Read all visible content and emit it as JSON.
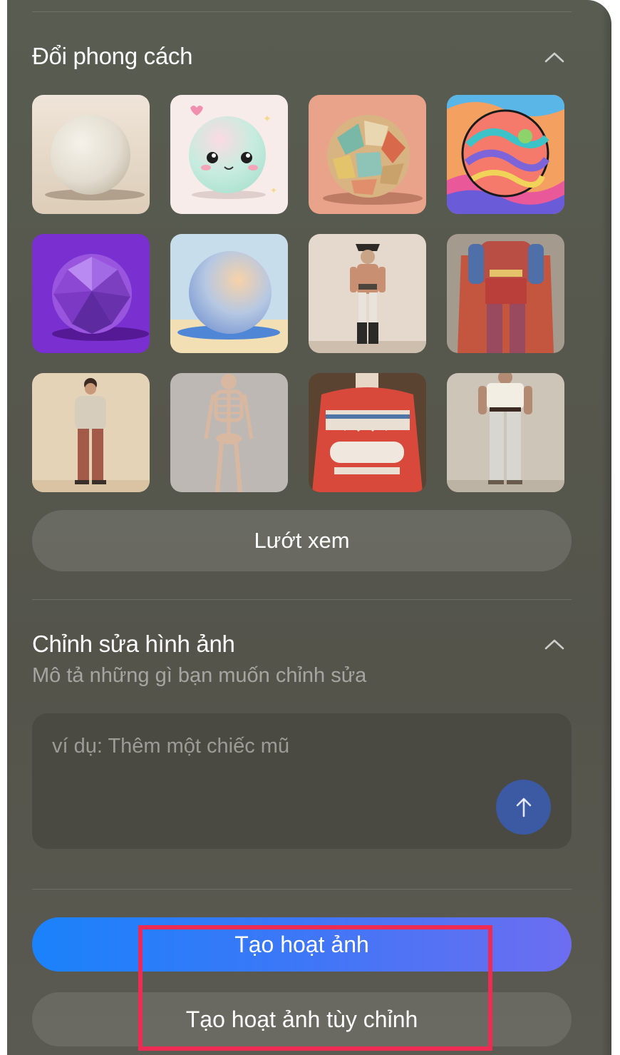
{
  "restyle": {
    "title": "Đổi phong cách",
    "browse_label": "Lướt xem",
    "styles": [
      {
        "icon": "clay-sphere"
      },
      {
        "icon": "cute-face-sphere"
      },
      {
        "icon": "paper-collage-sphere"
      },
      {
        "icon": "psychedelic-sphere"
      },
      {
        "icon": "low-poly-purple-sphere"
      },
      {
        "icon": "watercolor-sphere"
      },
      {
        "icon": "pirate-figure"
      },
      {
        "icon": "superhero-figure"
      },
      {
        "icon": "sweater-man-figure"
      },
      {
        "icon": "skeleton-figure"
      },
      {
        "icon": "knit-sweater-figure"
      },
      {
        "icon": "white-tshirt-man-figure"
      }
    ]
  },
  "edit_image": {
    "title": "Chỉnh sửa hình ảnh",
    "subtitle": "Mô tả những gì bạn muốn chỉnh sửa",
    "placeholder": "ví dụ: Thêm một chiếc mũ",
    "value": ""
  },
  "actions": {
    "animate_label": "Tạo hoạt ảnh",
    "custom_animate_label": "Tạo hoạt ảnh tùy chỉnh"
  },
  "colors": {
    "panel": "#56574d",
    "animate_gradient_start": "#1a82fb",
    "animate_gradient_end": "#6d6df0",
    "send_button": "#3c5aa4",
    "highlight": "#ee2b53"
  }
}
